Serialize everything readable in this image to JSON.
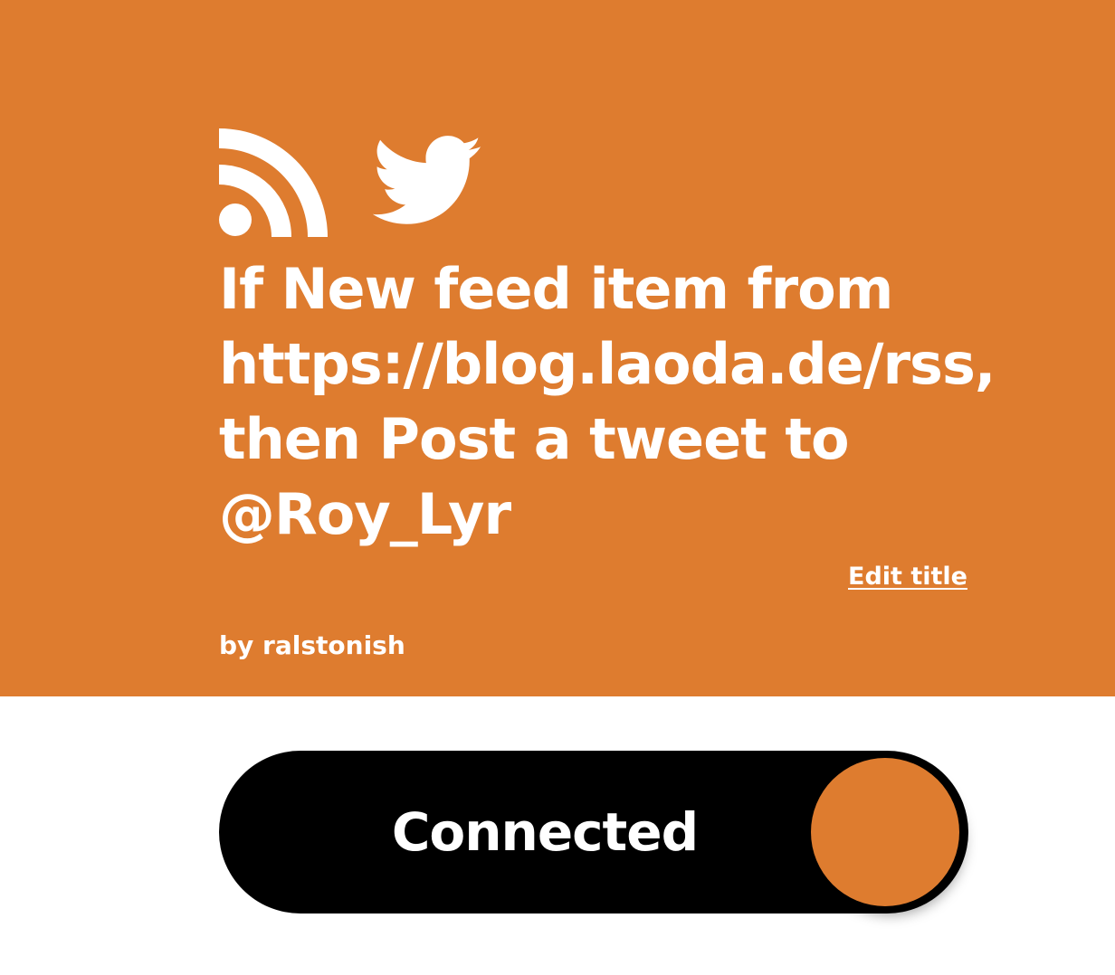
{
  "applet": {
    "title": "If New feed item from https://blog.laoda.de/rss, then Post a tweet to @Roy_Lyr",
    "edit_title_label": "Edit title",
    "author": "by ralstonish",
    "trigger_service_icon": "rss-icon",
    "action_service_icon": "twitter-icon",
    "brand_color": "#de7c2f"
  },
  "toggle": {
    "label": "Connected",
    "state": "on",
    "background_color": "#000000",
    "knob_color": "#de7c2f"
  }
}
